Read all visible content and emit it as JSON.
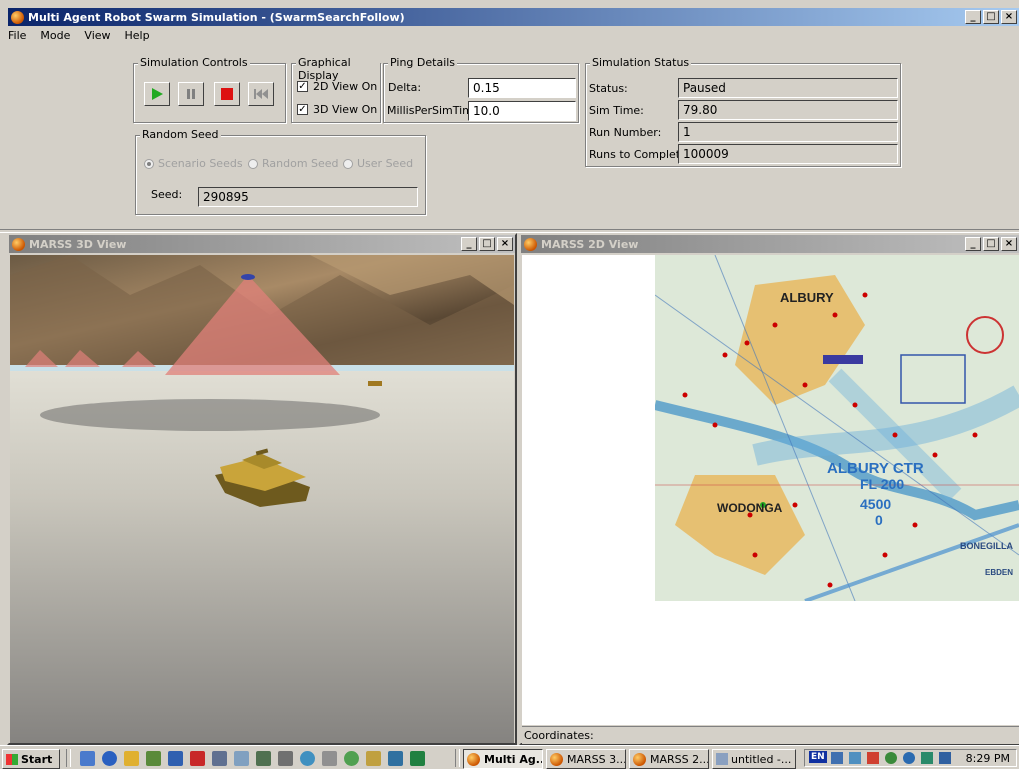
{
  "app": {
    "title": "Multi Agent Robot Swarm Simulation - (SwarmSearchFollow)",
    "menu": [
      "File",
      "Mode",
      "View",
      "Help"
    ]
  },
  "sim_controls": {
    "title": "Simulation Controls",
    "buttons": [
      "play",
      "pause",
      "stop",
      "rewind"
    ]
  },
  "graphical_display": {
    "title": "Graphical Display",
    "view2d": {
      "label": "2D View On",
      "checked": true
    },
    "view3d": {
      "label": "3D View On",
      "checked": true
    }
  },
  "ping_details": {
    "title": "Ping Details",
    "delta_label": "Delta:",
    "delta_value": "0.15",
    "millis_label": "MillisPerSimTime:",
    "millis_value": "10.0"
  },
  "sim_status": {
    "title": "Simulation Status",
    "status_label": "Status:",
    "status_value": "Paused",
    "simtime_label": "Sim Time:",
    "simtime_value": "79.80",
    "run_label": "Run Number:",
    "run_value": "1",
    "runs_label": "Runs to Complete:",
    "runs_value": "100009"
  },
  "random_seed": {
    "title": "Random Seed",
    "options": [
      {
        "label": "Scenario Seeds",
        "selected": true
      },
      {
        "label": "Random Seed",
        "selected": false
      },
      {
        "label": "User Seed",
        "selected": false
      }
    ],
    "seed_label": "Seed:",
    "seed_value": "290895"
  },
  "view3d_window": {
    "title": "MARSS 3D View"
  },
  "view2d_window": {
    "title": "MARSS 2D View",
    "coordinates_label": "Coordinates:",
    "map_labels": [
      "ALBURY",
      "ALBURY CTR",
      "FL 200",
      "4500",
      "0",
      "WODONGA",
      "BONEGILLA",
      "EBDEN"
    ]
  },
  "taskbar": {
    "start": "Start",
    "tasks": [
      "Multi Ag...",
      "MARSS 3...",
      "MARSS 2...",
      "untitled -..."
    ],
    "lang": "EN",
    "clock": "8:29 PM"
  },
  "colors": {
    "titlebar_active": "#0a246a",
    "face": "#d4d0c8",
    "play_green": "#22aa22",
    "stop_red": "#dd1111"
  }
}
